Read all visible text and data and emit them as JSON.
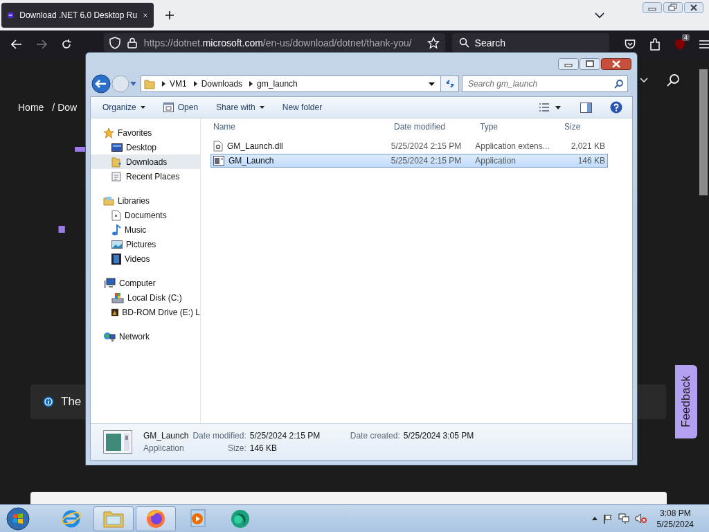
{
  "browser": {
    "tab": {
      "title": "Download .NET 6.0 Desktop Ru",
      "selected": true
    },
    "url": {
      "prefix": "https://dotnet.",
      "domain": "microsoft.com",
      "path": "/en-us/download/dotnet/thank-you/"
    },
    "search_placeholder": "Search",
    "extension_badge": "4"
  },
  "page": {
    "breadcrumb": [
      "Home",
      "/ Dow"
    ],
    "heading_lines": [
      "."
    ],
    "notice": "The",
    "feedback": "Feedback"
  },
  "explorer": {
    "breadcrumb": [
      "VM1",
      "Downloads",
      "gm_launch"
    ],
    "search_placeholder": "Search gm_launch",
    "toolbar": [
      {
        "label": "Organize",
        "kind": "menu"
      },
      {
        "label": "Open",
        "kind": "icon"
      },
      {
        "label": "Share with",
        "kind": "menu"
      },
      {
        "label": "New folder",
        "kind": "plain"
      }
    ],
    "nav": [
      {
        "label": "Favorites",
        "kind": "star",
        "selected": false,
        "children": [
          {
            "label": "Desktop",
            "kind": "desktop",
            "selected": false
          },
          {
            "label": "Downloads",
            "kind": "folder",
            "selected": true
          },
          {
            "label": "Recent Places",
            "kind": "recent",
            "selected": false
          }
        ]
      },
      {
        "label": "Libraries",
        "kind": "library",
        "selected": false,
        "children": [
          {
            "label": "Documents",
            "kind": "document",
            "selected": false
          },
          {
            "label": "Music",
            "kind": "music",
            "selected": false
          },
          {
            "label": "Pictures",
            "kind": "pictures",
            "selected": false
          },
          {
            "label": "Videos",
            "kind": "videos",
            "selected": false
          }
        ]
      },
      {
        "label": "Computer",
        "kind": "computer",
        "selected": false,
        "children": [
          {
            "label": "Local Disk (C:)",
            "kind": "disk",
            "selected": false
          },
          {
            "label": "BD-ROM Drive (E:) L",
            "kind": "disc",
            "selected": false
          }
        ]
      },
      {
        "label": "Network",
        "kind": "network",
        "selected": false
      }
    ],
    "columns": [
      "Name",
      "Date modified",
      "Type",
      "Size"
    ],
    "files": [
      {
        "name": "GM_Launch.dll",
        "date": "5/25/2024 2:15 PM",
        "type": "Application extens...",
        "size": "2,021 KB",
        "kind": "dll",
        "selected": false
      },
      {
        "name": "GM_Launch",
        "date": "5/25/2024 2:15 PM",
        "type": "Application",
        "size": "146 KB",
        "kind": "exe",
        "selected": true
      }
    ],
    "details": {
      "name": "GM_Launch",
      "type": "Application",
      "fields": [
        {
          "label": "Date modified:",
          "value": "5/25/2024 2:15 PM"
        },
        {
          "label": "Size:",
          "value": "146 KB"
        },
        {
          "label": "Date created:",
          "value": "5/25/2024 3:05 PM"
        }
      ]
    }
  },
  "taskbar": {
    "apps": [
      {
        "kind": "ie",
        "selected": false
      },
      {
        "kind": "explorer",
        "selected": true
      },
      {
        "kind": "firefox",
        "selected": true
      },
      {
        "kind": "media",
        "selected": false
      },
      {
        "kind": "green",
        "selected": false
      }
    ],
    "time": "3:08 PM",
    "date": "5/25/2024"
  }
}
